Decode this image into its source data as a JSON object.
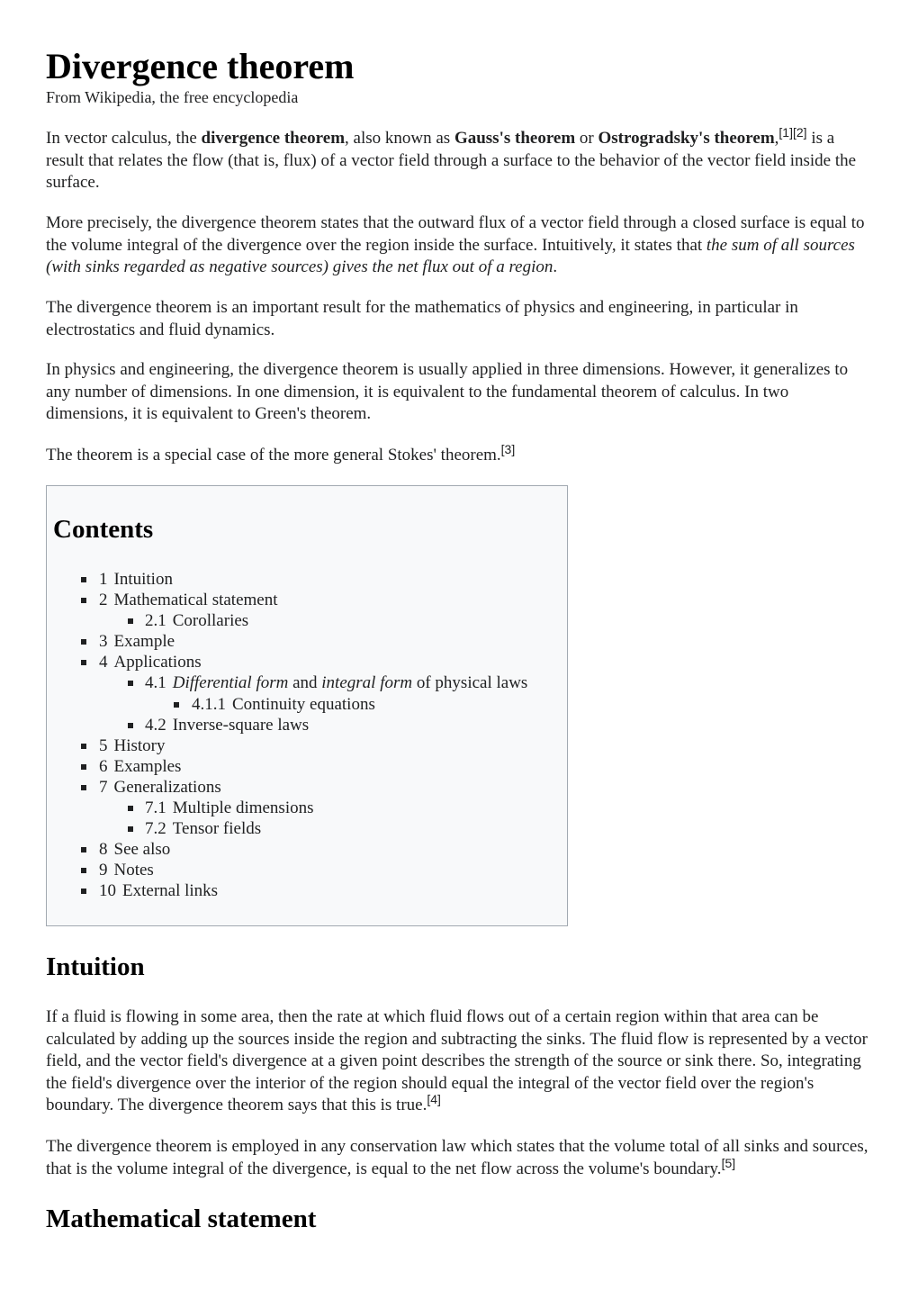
{
  "article": {
    "title": "Divergence theorem",
    "tagline": "From Wikipedia, the free encyclopedia"
  },
  "intro": {
    "p1": {
      "t1": "In vector calculus, the ",
      "b1": "divergence theorem",
      "t2": ", also known as ",
      "b2": "Gauss's theorem",
      "t3": " or ",
      "b3": "Ostrogradsky's theorem",
      "t4": ",",
      "ref1": "[1]",
      "ref2": "[2]",
      "t5": " is a result that relates the flow (that is, flux) of a vector field through a surface to the behavior of the vector field inside the surface."
    },
    "p2": {
      "t1": "More precisely, the divergence theorem states that the outward flux of a vector field through a closed surface is equal to the volume integral of the divergence over the region inside the surface. Intuitively, it states that ",
      "i1": "the sum of all sources (with sinks regarded as negative sources) gives the net flux out of a region",
      "t2": "."
    },
    "p3": "The divergence theorem is an important result for the mathematics of physics and engineering, in particular in electrostatics and fluid dynamics.",
    "p4": "In physics and engineering, the divergence theorem is usually applied in three dimensions. However, it generalizes to any number of dimensions. In one dimension, it is equivalent to the fundamental theorem of calculus. In two dimensions, it is equivalent to Green's theorem.",
    "p5": {
      "t1": "The theorem is a special case of the more general Stokes' theorem.",
      "ref": "[3]"
    }
  },
  "toc": {
    "title": "Contents",
    "items": [
      {
        "num": "1",
        "label": "Intuition",
        "level": 1
      },
      {
        "num": "2",
        "label": "Mathematical statement",
        "level": 1
      },
      {
        "num": "2.1",
        "label": "Corollaries",
        "level": 2
      },
      {
        "num": "3",
        "label": "Example",
        "level": 1
      },
      {
        "num": "4",
        "label": "Applications",
        "level": 1
      },
      {
        "num": "4.1",
        "label_i1": "Differential form",
        "label_t1": " and ",
        "label_i2": "integral form",
        "label_t2": " of physical laws",
        "level": 2
      },
      {
        "num": "4.1.1",
        "label": "Continuity equations",
        "level": 3
      },
      {
        "num": "4.2",
        "label": "Inverse-square laws",
        "level": 2
      },
      {
        "num": "5",
        "label": "History",
        "level": 1
      },
      {
        "num": "6",
        "label": "Examples",
        "level": 1
      },
      {
        "num": "7",
        "label": "Generalizations",
        "level": 1
      },
      {
        "num": "7.1",
        "label": "Multiple dimensions",
        "level": 2
      },
      {
        "num": "7.2",
        "label": "Tensor fields",
        "level": 2
      },
      {
        "num": "8",
        "label": "See also",
        "level": 1
      },
      {
        "num": "9",
        "label": "Notes",
        "level": 1
      },
      {
        "num": "10",
        "label": "External links",
        "level": 1
      }
    ]
  },
  "sections": {
    "intuition": {
      "heading": "Intuition",
      "p1": {
        "text": "If a fluid is flowing in some area, then the rate at which fluid flows out of a certain region within that area can be calculated by adding up the sources inside the region and subtracting the sinks. The fluid flow is represented by a vector field, and the vector field's divergence at a given point describes the strength of the source or sink there. So, integrating the field's divergence over the interior of the region should equal the integral of the vector field over the region's boundary. The divergence theorem says that this is true.",
        "ref": "[4]"
      },
      "p2": {
        "text": "The divergence theorem is employed in any conservation law which states that the volume total of all sinks and sources, that is the volume integral of the divergence, is equal to the net flow across the volume's boundary.",
        "ref": "[5]"
      }
    },
    "math": {
      "heading": "Mathematical statement"
    }
  }
}
